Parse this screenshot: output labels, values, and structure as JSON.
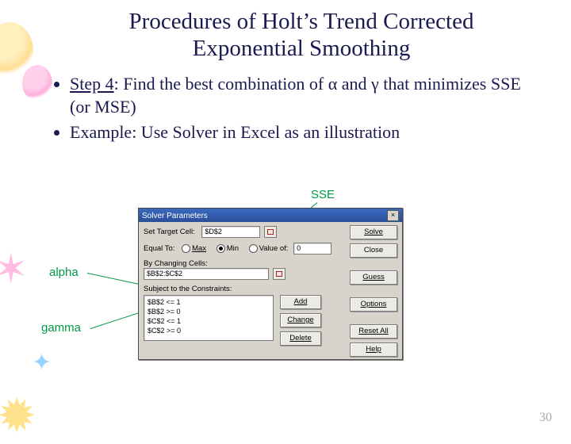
{
  "title_line1": "Procedures of Holt’s Trend Corrected",
  "title_line2": "Exponential Smoothing",
  "bullets": {
    "b1_lead": "Step 4",
    "b1_rest": ": Find the best combination of α and γ that minimizes SSE (or MSE)",
    "b2": "Example: Use Solver in Excel as an illustration"
  },
  "annotations": {
    "sse": "SSE",
    "alpha": "alpha",
    "gamma": "gamma"
  },
  "solver": {
    "title": "Solver Parameters",
    "close_glyph": "×",
    "set_target": "Set Target Cell:",
    "target_value": "$D$2",
    "equal_to": "Equal To:",
    "opt_max": "Max",
    "opt_min": "Min",
    "opt_value": "Value of:",
    "value_of": "0",
    "by_changing": "By Changing Cells:",
    "changing_value": "$B$2:$C$2",
    "subject": "Subject to the Constraints:",
    "constraints": [
      "$B$2 <= 1",
      "$B$2 >= 0",
      "$C$2 <= 1",
      "$C$2 >= 0"
    ],
    "btn_solve": "Solve",
    "btn_close": "Close",
    "btn_guess": "Guess",
    "btn_options": "Options",
    "btn_reset": "Reset All",
    "btn_help": "Help",
    "btn_add": "Add",
    "btn_change": "Change",
    "btn_delete": "Delete"
  },
  "slide_number": "30"
}
